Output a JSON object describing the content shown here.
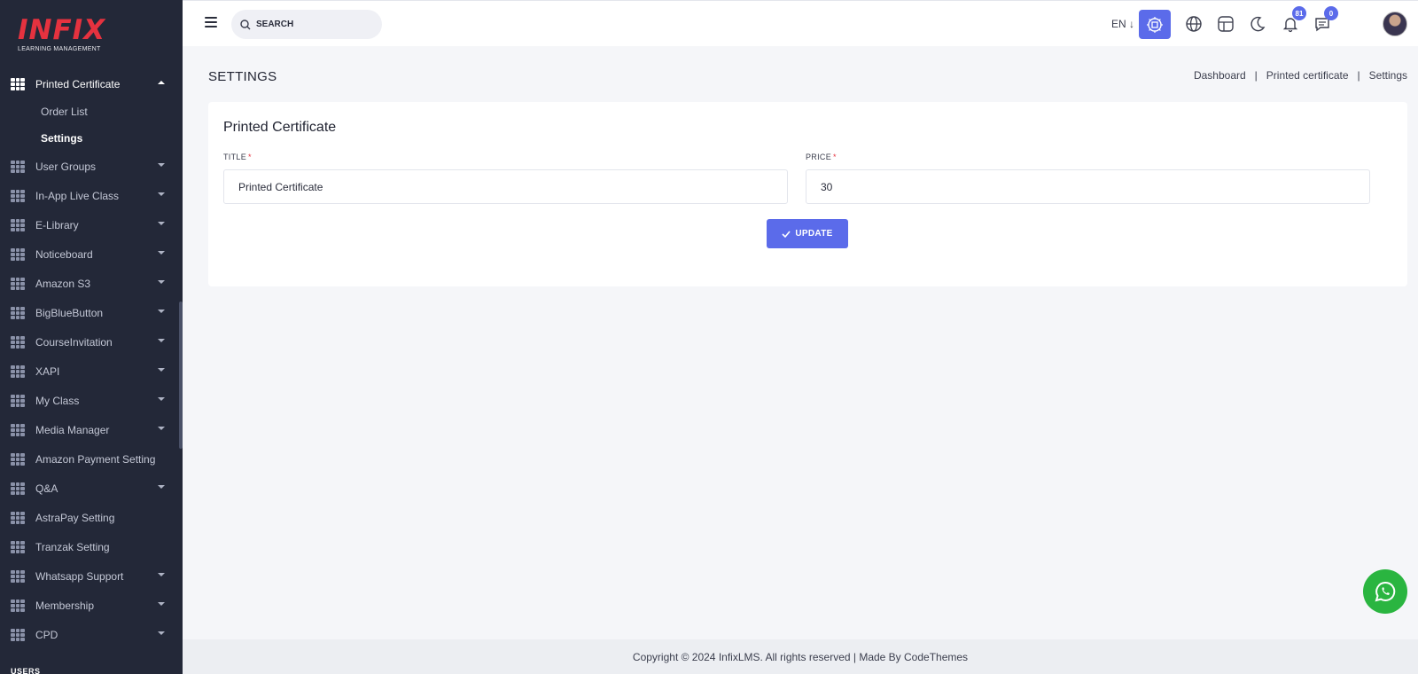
{
  "logo": {
    "text": "INFIX",
    "subtitle": "LEARNING MANAGEMENT"
  },
  "sidebar": {
    "active_menu": {
      "label": "Printed Certificate",
      "children": [
        {
          "label": "Order List"
        },
        {
          "label": "Settings"
        }
      ]
    },
    "items": [
      {
        "label": "User Groups",
        "has_arrow": true
      },
      {
        "label": "In-App Live Class",
        "has_arrow": true
      },
      {
        "label": "E-Library",
        "has_arrow": true
      },
      {
        "label": "Noticeboard",
        "has_arrow": true
      },
      {
        "label": "Amazon S3",
        "has_arrow": true
      },
      {
        "label": "BigBlueButton",
        "has_arrow": true
      },
      {
        "label": "CourseInvitation",
        "has_arrow": true
      },
      {
        "label": "XAPI",
        "has_arrow": true
      },
      {
        "label": "My Class",
        "has_arrow": true
      },
      {
        "label": "Media Manager",
        "has_arrow": true
      },
      {
        "label": "Amazon Payment Setting",
        "has_arrow": false
      },
      {
        "label": "Q&A",
        "has_arrow": true
      },
      {
        "label": "AstraPay Setting",
        "has_arrow": false
      },
      {
        "label": "Tranzak Setting",
        "has_arrow": false
      },
      {
        "label": "Whatsapp Support",
        "has_arrow": true
      },
      {
        "label": "Membership",
        "has_arrow": true
      },
      {
        "label": "CPD",
        "has_arrow": true
      }
    ],
    "section_label": "USERS"
  },
  "topbar": {
    "search_placeholder": "SEARCH",
    "language": "EN ↓",
    "notification_count": "81",
    "message_count": "0"
  },
  "page": {
    "title": "SETTINGS",
    "breadcrumb": [
      "Dashboard",
      "Printed certificate",
      "Settings"
    ],
    "breadcrumb_separator": "|"
  },
  "form": {
    "card_title": "Printed Certificate",
    "title_label": "TITLE",
    "title_value": "Printed Certificate",
    "price_label": "PRICE",
    "price_value": "30",
    "required_mark": "*",
    "update_label": "UPDATE"
  },
  "footer": {
    "text": "Copyright © 2024 InfixLMS. All rights reserved | Made By CodeThemes"
  },
  "colors": {
    "accent": "#5b6bea",
    "sidebar_bg": "#232838",
    "brand_red": "#e5323f",
    "whatsapp": "#2ab540"
  }
}
